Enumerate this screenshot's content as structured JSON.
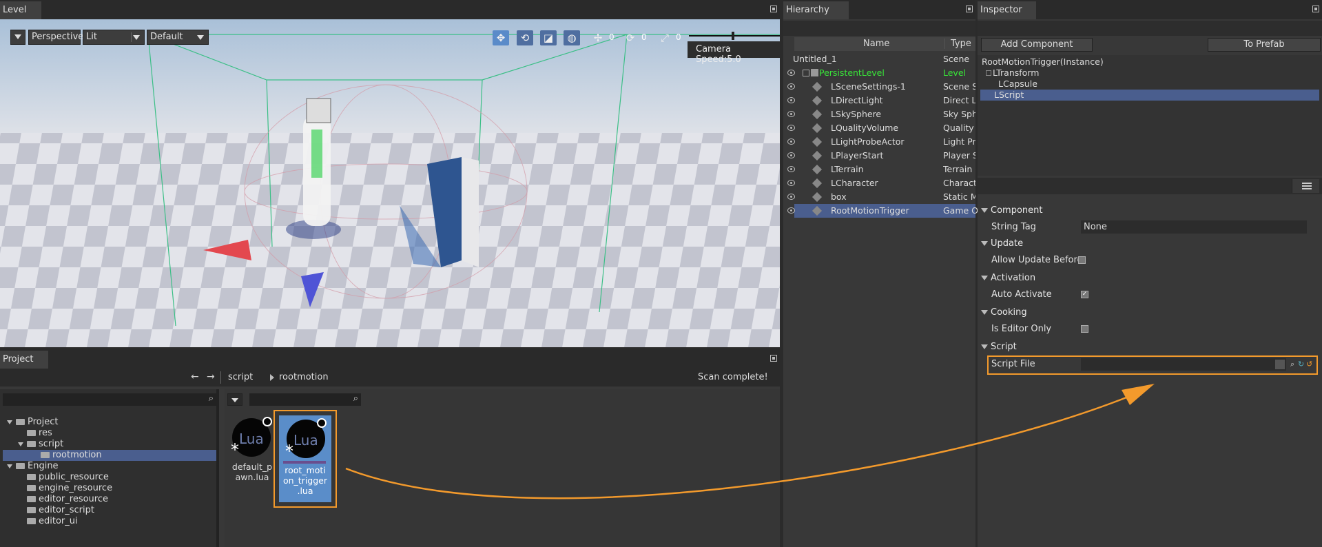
{
  "level": {
    "tab_label": "Level",
    "view_mode": "Perspective",
    "lighting": "Lit",
    "preset": "Default",
    "camera_speed": "Camera Speed:5.0",
    "counts": [
      "0",
      "0",
      "0"
    ]
  },
  "hierarchy": {
    "tab_label": "Hierarchy",
    "col_name": "Name",
    "col_type": "Type",
    "items": [
      {
        "name": "Untitled_1",
        "type": "Scene"
      },
      {
        "name": "PersistentLevel",
        "type": "Level"
      },
      {
        "name": "LSceneSettings-1",
        "type": "Scene Sett"
      },
      {
        "name": "LDirectLight",
        "type": "Direct Ligh"
      },
      {
        "name": "LSkySphere",
        "type": "Sky Spher"
      },
      {
        "name": "LQualityVolume",
        "type": "Quality Vo"
      },
      {
        "name": "LLightProbeActor",
        "type": "Light Prob"
      },
      {
        "name": "LPlayerStart",
        "type": "Player Sta"
      },
      {
        "name": "LTerrain",
        "type": "Terrain Ob"
      },
      {
        "name": "LCharacter",
        "type": "Character"
      },
      {
        "name": "box",
        "type": "Static Mes"
      },
      {
        "name": "RootMotionTrigger",
        "type": "Game Obj"
      }
    ]
  },
  "inspector": {
    "tab_label": "Inspector",
    "add_component": "Add Component",
    "to_prefab": "To Prefab",
    "tree": [
      "RootMotionTrigger(Instance)",
      "LTransform",
      "LCapsule",
      "LScript"
    ],
    "sections": {
      "component": "Component",
      "update": "Update",
      "activation": "Activation",
      "cooking": "Cooking",
      "script": "Script"
    },
    "props": {
      "string_tag_label": "String Tag",
      "string_tag_value": "None",
      "allow_update_label": "Allow Update Before",
      "auto_activate_label": "Auto Activate",
      "is_editor_only_label": "Is Editor Only",
      "script_file_label": "Script File",
      "script_file_value": ""
    }
  },
  "project": {
    "tab_label": "Project",
    "breadcrumb": [
      "script",
      "rootmotion"
    ],
    "status": "Scan complete!",
    "tree": [
      {
        "label": "Project",
        "level": 0
      },
      {
        "label": "res",
        "level": 1
      },
      {
        "label": "script",
        "level": 1
      },
      {
        "label": "rootmotion",
        "level": 2
      },
      {
        "label": "Engine",
        "level": 0
      },
      {
        "label": "public_resource",
        "level": 1
      },
      {
        "label": "engine_resource",
        "level": 1
      },
      {
        "label": "editor_resource",
        "level": 1
      },
      {
        "label": "editor_script",
        "level": 1
      },
      {
        "label": "editor_ui",
        "level": 1
      }
    ],
    "files": [
      {
        "name": "default_p\nawn.lua",
        "icon_text": "Lua"
      },
      {
        "name": "root_moti\non_trigger\n.lua",
        "icon_text": "Lua"
      }
    ]
  },
  "colors": {
    "accent": "#f39a2c",
    "selection": "#4a5e8e",
    "level_green": "#39e639"
  }
}
